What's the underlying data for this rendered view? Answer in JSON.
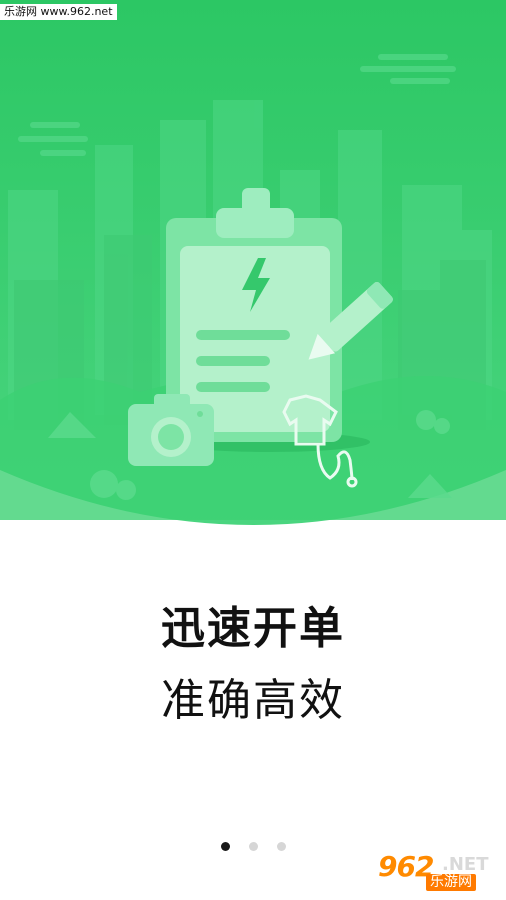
{
  "watermark_top": "乐游网 www.962.net",
  "headline": "迅速开单",
  "subheadline": "准确高效",
  "pager": {
    "total": 3,
    "active": 0
  },
  "watermark_logo": {
    "number": "962",
    "suffix": ".NET",
    "cn": "乐游网"
  },
  "colors": {
    "green_top": "#2fc968",
    "green_bottom": "#46d47c",
    "paper": "#a8efc3"
  }
}
